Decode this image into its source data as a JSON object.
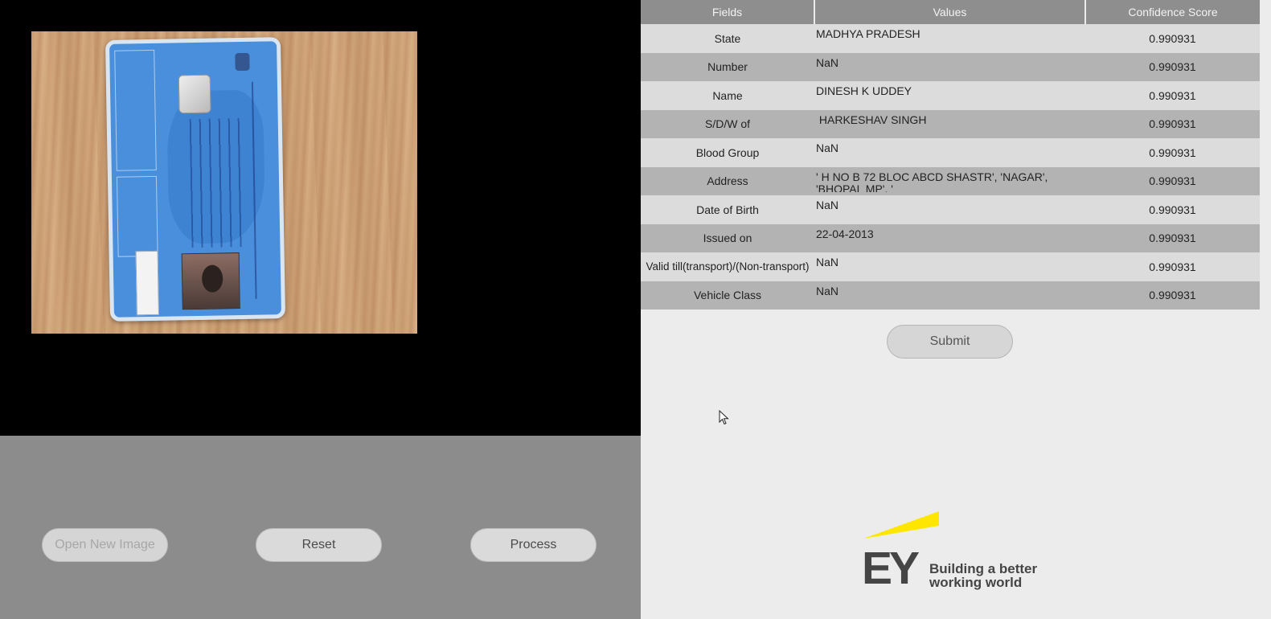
{
  "table": {
    "headers": [
      "Fields",
      "Values",
      "Confidence Score"
    ],
    "rows": [
      {
        "field": "State",
        "value": "MADHYA PRADESH",
        "score": "0.990931"
      },
      {
        "field": "Number",
        "value": "NaN",
        "score": "0.990931"
      },
      {
        "field": "Name",
        "value": "DINESH K UDDEY",
        "score": "0.990931"
      },
      {
        "field": "S/D/W of",
        "value": " HARKESHAV SINGH",
        "score": "0.990931"
      },
      {
        "field": "Blood Group",
        "value": "NaN",
        "score": "0.990931"
      },
      {
        "field": "Address",
        "value": "' H NO B 72 BLOC ABCD SHASTR', 'NAGAR', 'BHOPAL  MP', '",
        "score": "0.990931"
      },
      {
        "field": "Date of Birth",
        "value": "NaN",
        "score": "0.990931"
      },
      {
        "field": "Issued on",
        "value": "22-04-2013",
        "score": "0.990931"
      },
      {
        "field": "Valid till(transport)/(Non-transport)",
        "value": "NaN",
        "score": "0.990931"
      },
      {
        "field": "Vehicle Class",
        "value": "NaN",
        "score": "0.990931"
      }
    ]
  },
  "buttons": {
    "submit": "Submit",
    "open_new_image": "Open New Image",
    "reset": "Reset",
    "process": "Process"
  },
  "branding": {
    "logo_letters": "EY",
    "tagline_line1": "Building a better",
    "tagline_line2": "working world",
    "accent_color": "#ffe600",
    "text_color": "#454545"
  },
  "icons": {
    "cursor": "mouse-pointer-icon"
  }
}
